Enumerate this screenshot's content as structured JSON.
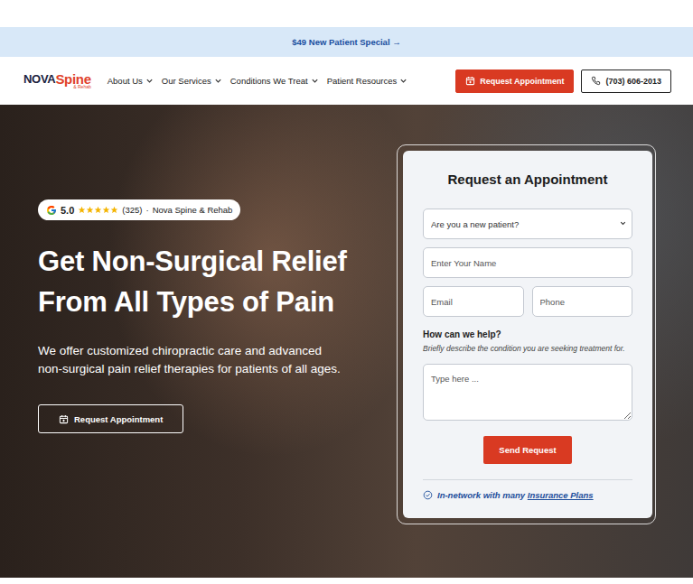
{
  "promo": {
    "text": "$49 New Patient Special →"
  },
  "logo": {
    "brand": "NOVA",
    "accent": "Spine",
    "sub": "& Rehab"
  },
  "nav": {
    "items": [
      "About Us",
      "Our Services",
      "Conditions We Treat",
      "Patient Resources"
    ],
    "cta": "Request Appointment",
    "phone": "(703) 606-2013"
  },
  "hero": {
    "rating": {
      "score": "5.0",
      "stars": 5,
      "count": "(325)",
      "separator": "·",
      "name": "Nova Spine & Rehab"
    },
    "title": "Get Non-Surgical Relief From All Types of Pain",
    "text": "We offer customized chiropractic care and advanced non-surgical pain relief therapies for patients of all ages.",
    "button": "Request Appointment"
  },
  "form": {
    "title": "Request an Appointment",
    "select_placeholder": "Are you a new patient?",
    "name_placeholder": "Enter Your Name",
    "email_placeholder": "Email",
    "phone_placeholder": "Phone",
    "help_label": "How can we help?",
    "help_hint": "Briefly describe the condition you are seeking treatment for.",
    "message_placeholder": "Type here ...",
    "submit": "Send Request",
    "insurance_text": "In-network with many ",
    "insurance_link": "Insurance Plans"
  }
}
